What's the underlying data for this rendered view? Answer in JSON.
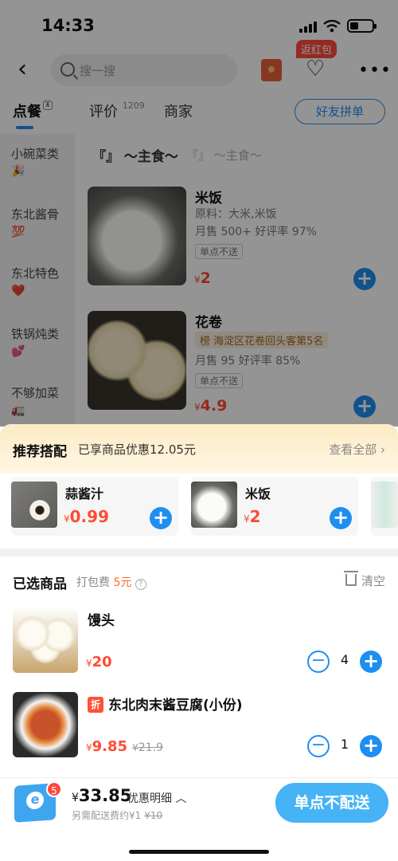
{
  "status": {
    "time": "14:33"
  },
  "nav": {
    "search_placeholder": "搜一搜",
    "return_badge": "返红包"
  },
  "tabs": [
    {
      "label": "点餐"
    },
    {
      "label": "评价",
      "count": "1209"
    },
    {
      "label": "商家"
    }
  ],
  "group_order_label": "好友拼单",
  "sidebar": {
    "items": [
      {
        "label": "小碗菜类",
        "emoji": "🎉"
      },
      {
        "label": "东北酱骨",
        "emoji": "💯"
      },
      {
        "label": "东北特色",
        "emoji": "❤️"
      },
      {
        "label": "铁锅炖类",
        "emoji": "💕"
      },
      {
        "label": "不够加菜",
        "emoji": "🚛"
      }
    ]
  },
  "section": {
    "title": "『』 ～主食～",
    "subtitle": "『』 ～主食～"
  },
  "foods": [
    {
      "name": "米饭",
      "ingredients": "原料：大米,米饭",
      "sales": "月售 500+ 好评率 97%",
      "tag": "单点不送",
      "price": "2"
    },
    {
      "name": "花卷",
      "rank": "榜 海淀区花卷回头客第5名",
      "sales": "月售 95 好评率 85%",
      "tag": "单点不送",
      "price": "4.9"
    }
  ],
  "recommend": {
    "title": "推荐搭配",
    "desc": "已享商品优惠12.05元",
    "view_all": "查看全部 ›",
    "items": [
      {
        "name": "蒜酱汁",
        "price": "0.99"
      },
      {
        "name": "米饭",
        "price": "2"
      }
    ]
  },
  "selected": {
    "title": "已选商品",
    "fee_label": "打包费",
    "fee_value": "5元",
    "clear_label": "清空",
    "items": [
      {
        "name": "馒头",
        "price": "20",
        "old_price": "",
        "qty": "4",
        "discount": ""
      },
      {
        "name": "东北肉末酱豆腐(小份)",
        "price": "9.85",
        "old_price": "21.9",
        "qty": "1",
        "discount": "折"
      }
    ]
  },
  "bottom": {
    "cart_count": "5",
    "total": "33.85",
    "discount_detail": "优惠明细 ︿",
    "delivery_note": "另需配送费约¥1",
    "delivery_old": "¥10",
    "checkout_label": "单点不配送"
  },
  "yen": "¥"
}
